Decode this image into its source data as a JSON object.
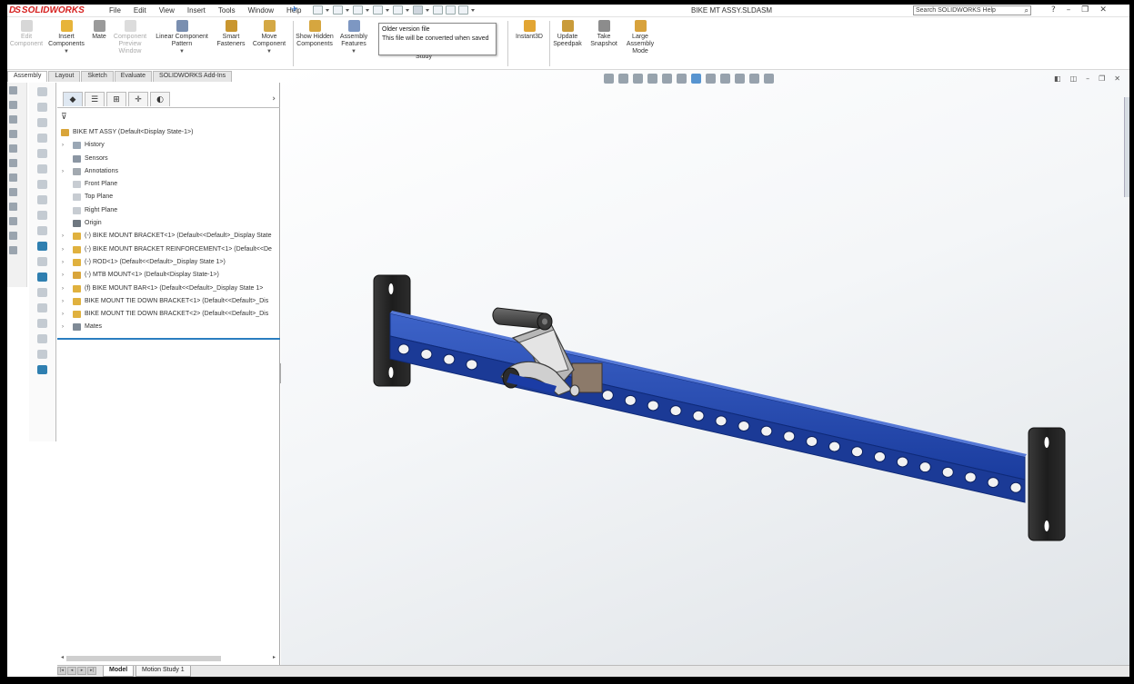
{
  "app": {
    "logo_text": "SOLIDWORKS",
    "logo_mark": "DS"
  },
  "menu": [
    "File",
    "Edit",
    "View",
    "Insert",
    "Tools",
    "Window",
    "Help"
  ],
  "document_title": "BIKE MT ASSY.SLDASM",
  "search_placeholder": "Search SOLIDWORKS Help",
  "commands": [
    {
      "label": "Edit Component"
    },
    {
      "label": "Insert Components"
    },
    {
      "label": "Mate"
    },
    {
      "label": "Component Preview Window"
    },
    {
      "label": "Linear Component Pattern"
    },
    {
      "label": "Smart Fasteners"
    },
    {
      "label": "Move Component"
    },
    {
      "label": "Show Hidden Components"
    },
    {
      "label": "Assembly Features"
    },
    {
      "label": "Study"
    },
    {
      "label": "Instant3D"
    },
    {
      "label": "Update Speedpak"
    },
    {
      "label": "Take Snapshot"
    },
    {
      "label": "Large Assembly Mode"
    }
  ],
  "tooltip": {
    "title": "Older version file",
    "body": "This file will be converted when saved"
  },
  "command_tabs": [
    "Assembly",
    "Layout",
    "Sketch",
    "Evaluate",
    "SOLIDWORKS Add-Ins"
  ],
  "tree": {
    "root": "BIKE MT ASSY  (Default<Display State-1>)",
    "items": [
      {
        "label": "History",
        "expandable": true
      },
      {
        "label": "Sensors",
        "expandable": false
      },
      {
        "label": "Annotations",
        "expandable": true
      },
      {
        "label": "Front Plane",
        "expandable": false
      },
      {
        "label": "Top Plane",
        "expandable": false
      },
      {
        "label": "Right Plane",
        "expandable": false
      },
      {
        "label": "Origin",
        "expandable": false
      },
      {
        "label": "(-) BIKE MOUNT BRACKET<1> (Default<<Default>_Display State",
        "expandable": true
      },
      {
        "label": "(-) BIKE MOUNT BRACKET REINFORCEMENT<1> (Default<<De",
        "expandable": true
      },
      {
        "label": "(-) ROD<1> (Default<<Default>_Display State 1>)",
        "expandable": true
      },
      {
        "label": "(-) MTB MOUNT<1> (Default<Display State-1>)",
        "expandable": true
      },
      {
        "label": "(f) BIKE MOUNT BAR<1> (Default<<Default>_Display State 1>",
        "expandable": true
      },
      {
        "label": "BIKE MOUNT TIE DOWN BRACKET<1> (Default<<Default>_Dis",
        "expandable": true
      },
      {
        "label": "BIKE MOUNT TIE DOWN BRACKET<2> (Default<<Default>_Dis",
        "expandable": true
      },
      {
        "label": "Mates",
        "expandable": true
      }
    ]
  },
  "bottom_tabs": [
    "Model",
    "Motion Study 1"
  ],
  "colors": {
    "bar_blue": "#1c3fa0",
    "bracket_black": "#222222",
    "accent": "#2a7dc0"
  }
}
